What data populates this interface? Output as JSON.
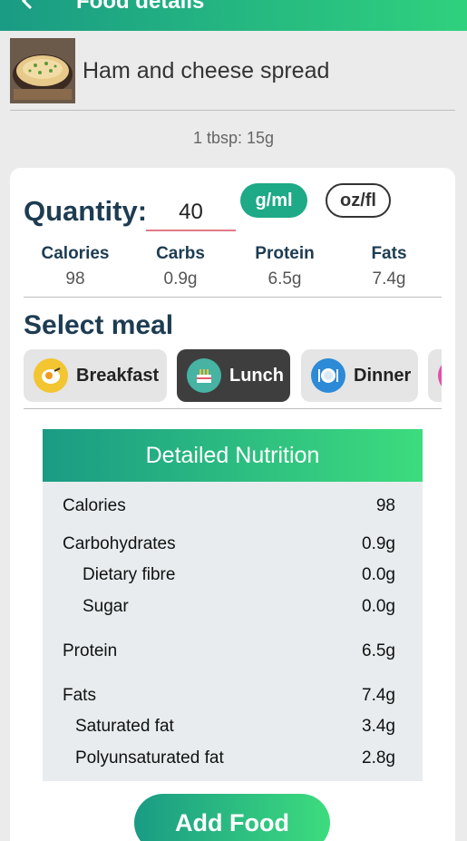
{
  "header": {
    "title": "Food details"
  },
  "food": {
    "name": "Ham and cheese spread",
    "serving": "1 tbsp: 15g"
  },
  "quantity": {
    "label": "Quantity:",
    "value": "40",
    "unit_gml": "g/ml",
    "unit_ozfl": "oz/fl"
  },
  "macros": [
    {
      "label": "Calories",
      "value": "98"
    },
    {
      "label": "Carbs",
      "value": "0.9g"
    },
    {
      "label": "Protein",
      "value": "6.5g"
    },
    {
      "label": "Fats",
      "value": "7.4g"
    }
  ],
  "meal": {
    "title": "Select meal",
    "options": [
      {
        "label": "Breakfast",
        "icon": "breakfast-icon"
      },
      {
        "label": "Lunch",
        "icon": "lunch-cake-icon"
      },
      {
        "label": "Dinner",
        "icon": "dinner-plate-icon"
      }
    ],
    "selected": "Lunch"
  },
  "nutrition": {
    "title": "Detailed Nutrition",
    "rows": [
      {
        "label": "Calories",
        "value": "98"
      },
      {
        "label": "Carbohydrates",
        "value": "0.9g"
      },
      {
        "label": "Dietary fibre",
        "value": "0.0g"
      },
      {
        "label": "Sugar",
        "value": "0.0g"
      },
      {
        "label": "Protein",
        "value": "6.5g"
      },
      {
        "label": "Fats",
        "value": "7.4g"
      },
      {
        "label": "Saturated fat",
        "value": "3.4g"
      },
      {
        "label": "Polyunsaturated fat",
        "value": "2.8g"
      }
    ]
  },
  "actions": {
    "add_food": "Add Food"
  },
  "colors": {
    "accent_start": "#1a9b84",
    "accent_end": "#3ddc7e",
    "heading": "#1d3c52",
    "selected_meal": "#3e3e3e"
  }
}
